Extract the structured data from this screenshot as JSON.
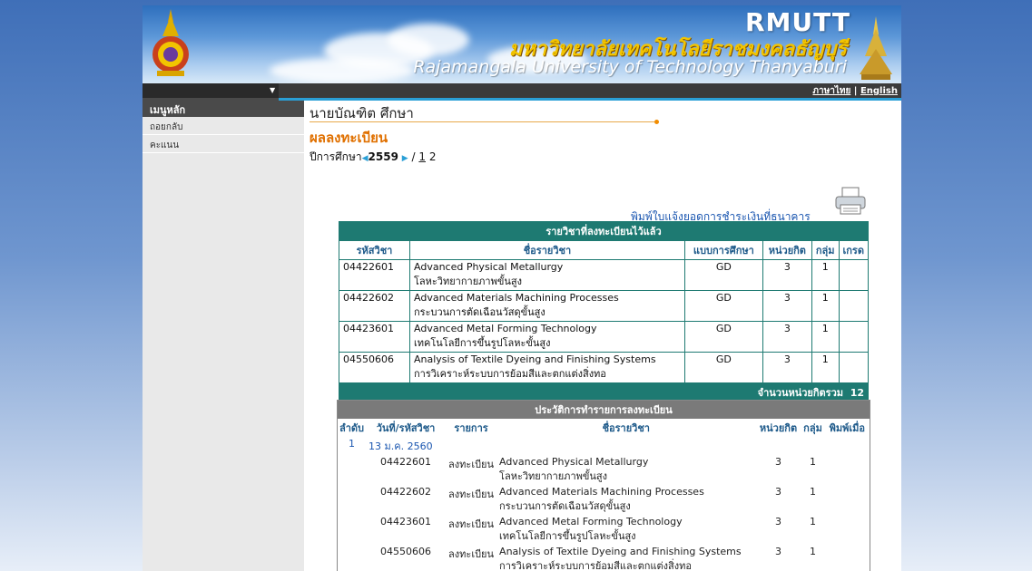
{
  "banner": {
    "abbr": "RMUTT",
    "name_th": "มหาวิทยาลัยเทคโนโลยีราชมงคลธัญบุรี",
    "name_en": "Rajamangala University of Technology Thanyaburi"
  },
  "topbar": {
    "lang_th": "ภาษาไทย",
    "lang_sep": " | ",
    "lang_en": "English"
  },
  "sidebar": {
    "title": "เมนูหลัก",
    "items": [
      {
        "label": "ถอยกลับ"
      },
      {
        "label": "คะแนน"
      }
    ]
  },
  "student": {
    "name": "นายบัณฑิต ศึกษา"
  },
  "section": {
    "title": "ผลลงทะเบียน"
  },
  "term": {
    "label": "ปีการศึกษา",
    "year": "2559",
    "sep": " / ",
    "semesters": [
      "1",
      "2"
    ]
  },
  "print_link": "พิมพ์ใบแจ้งยอดการชำระเงินที่ธนาคาร",
  "registered": {
    "caption": "รายวิชาที่ลงทะเบียนไว้แล้ว",
    "headers": [
      "รหัสวิชา",
      "ชื่อรายวิชา",
      "แบบการศึกษา",
      "หน่วยกิต",
      "กลุ่ม",
      "เกรด"
    ],
    "rows": [
      {
        "code": "04422601",
        "name_en": "Advanced Physical Metallurgy",
        "name_th": "โลหะวิทยากายภาพขั้นสูง",
        "mode": "GD",
        "credit": "3",
        "group": "1",
        "grade": ""
      },
      {
        "code": "04422602",
        "name_en": "Advanced Materials Machining Processes",
        "name_th": "กระบวนการตัดเฉือนวัสดุขั้นสูง",
        "mode": "GD",
        "credit": "3",
        "group": "1",
        "grade": ""
      },
      {
        "code": "04423601",
        "name_en": "Advanced Metal Forming Technology",
        "name_th": "เทคโนโลยีการขึ้นรูปโลหะขั้นสูง",
        "mode": "GD",
        "credit": "3",
        "group": "1",
        "grade": ""
      },
      {
        "code": "04550606",
        "name_en": "Analysis of Textile Dyeing and Finishing Systems",
        "name_th": "การวิเคราะห์ระบบการย้อมสีและตกแต่งสิ่งทอ",
        "mode": "GD",
        "credit": "3",
        "group": "1",
        "grade": ""
      }
    ],
    "total_label": "จำนวนหน่วยกิตรวม",
    "total_value": "12"
  },
  "history": {
    "caption": "ประวัติการทำรายการลงทะเบียน",
    "headers": [
      "ลำดับ",
      "วันที่/รหัสวิชา",
      "รายการ",
      "ชื่อรายวิชา",
      "หน่วยกิต",
      "กลุ่ม",
      "พิมพ์เมื่อ"
    ],
    "entries": [
      {
        "seq": "1",
        "date": "13 ม.ค. 2560",
        "rows": [
          {
            "code": "04422601",
            "action": "ลงทะเบียน",
            "name_en": "Advanced Physical Metallurgy",
            "name_th": "โลหะวิทยากายภาพขั้นสูง",
            "credit": "3",
            "group": "1"
          },
          {
            "code": "04422602",
            "action": "ลงทะเบียน",
            "name_en": "Advanced Materials Machining Processes",
            "name_th": "กระบวนการตัดเฉือนวัสดุขั้นสูง",
            "credit": "3",
            "group": "1"
          },
          {
            "code": "04423601",
            "action": "ลงทะเบียน",
            "name_en": "Advanced Metal Forming Technology",
            "name_th": "เทคโนโลยีการขึ้นรูปโลหะขั้นสูง",
            "credit": "3",
            "group": "1"
          },
          {
            "code": "04550606",
            "action": "ลงทะเบียน",
            "name_en": "Analysis of Textile Dyeing and Finishing Systems",
            "name_th": "การวิเคราะห์ระบบการย้อมสีและตกแต่งสิ่งทอ",
            "credit": "3",
            "group": "1"
          }
        ]
      }
    ]
  },
  "colors": {
    "accent_teal": "#1e7a72",
    "title_orange": "#e07000",
    "link_blue": "#1a56b0"
  },
  "icons": {
    "printer": "printer-icon",
    "crest": "university-crest-icon",
    "pagoda": "pagoda-icon"
  }
}
